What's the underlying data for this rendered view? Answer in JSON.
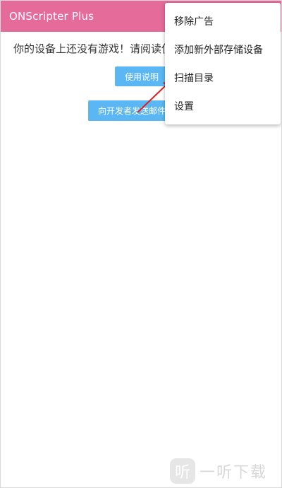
{
  "app_bar": {
    "title": "ONScripter Plus",
    "color": "#e46b9a"
  },
  "main": {
    "empty_message": "你的设备上还没有游戏！请阅读使用说明",
    "manual_button": "使用说明",
    "email_button": "向开发者发送邮件"
  },
  "overflow_menu": {
    "items": [
      {
        "label": "移除广告"
      },
      {
        "label": "添加新外部存储设备"
      },
      {
        "label": "扫描目录"
      },
      {
        "label": "设置"
      }
    ]
  },
  "annotation": {
    "arrow_color": "#e02020"
  },
  "watermark": {
    "icon_glyph": "听",
    "text": "一听下载"
  },
  "colors": {
    "button": "#5bb7f4",
    "background": "#ffffff"
  }
}
